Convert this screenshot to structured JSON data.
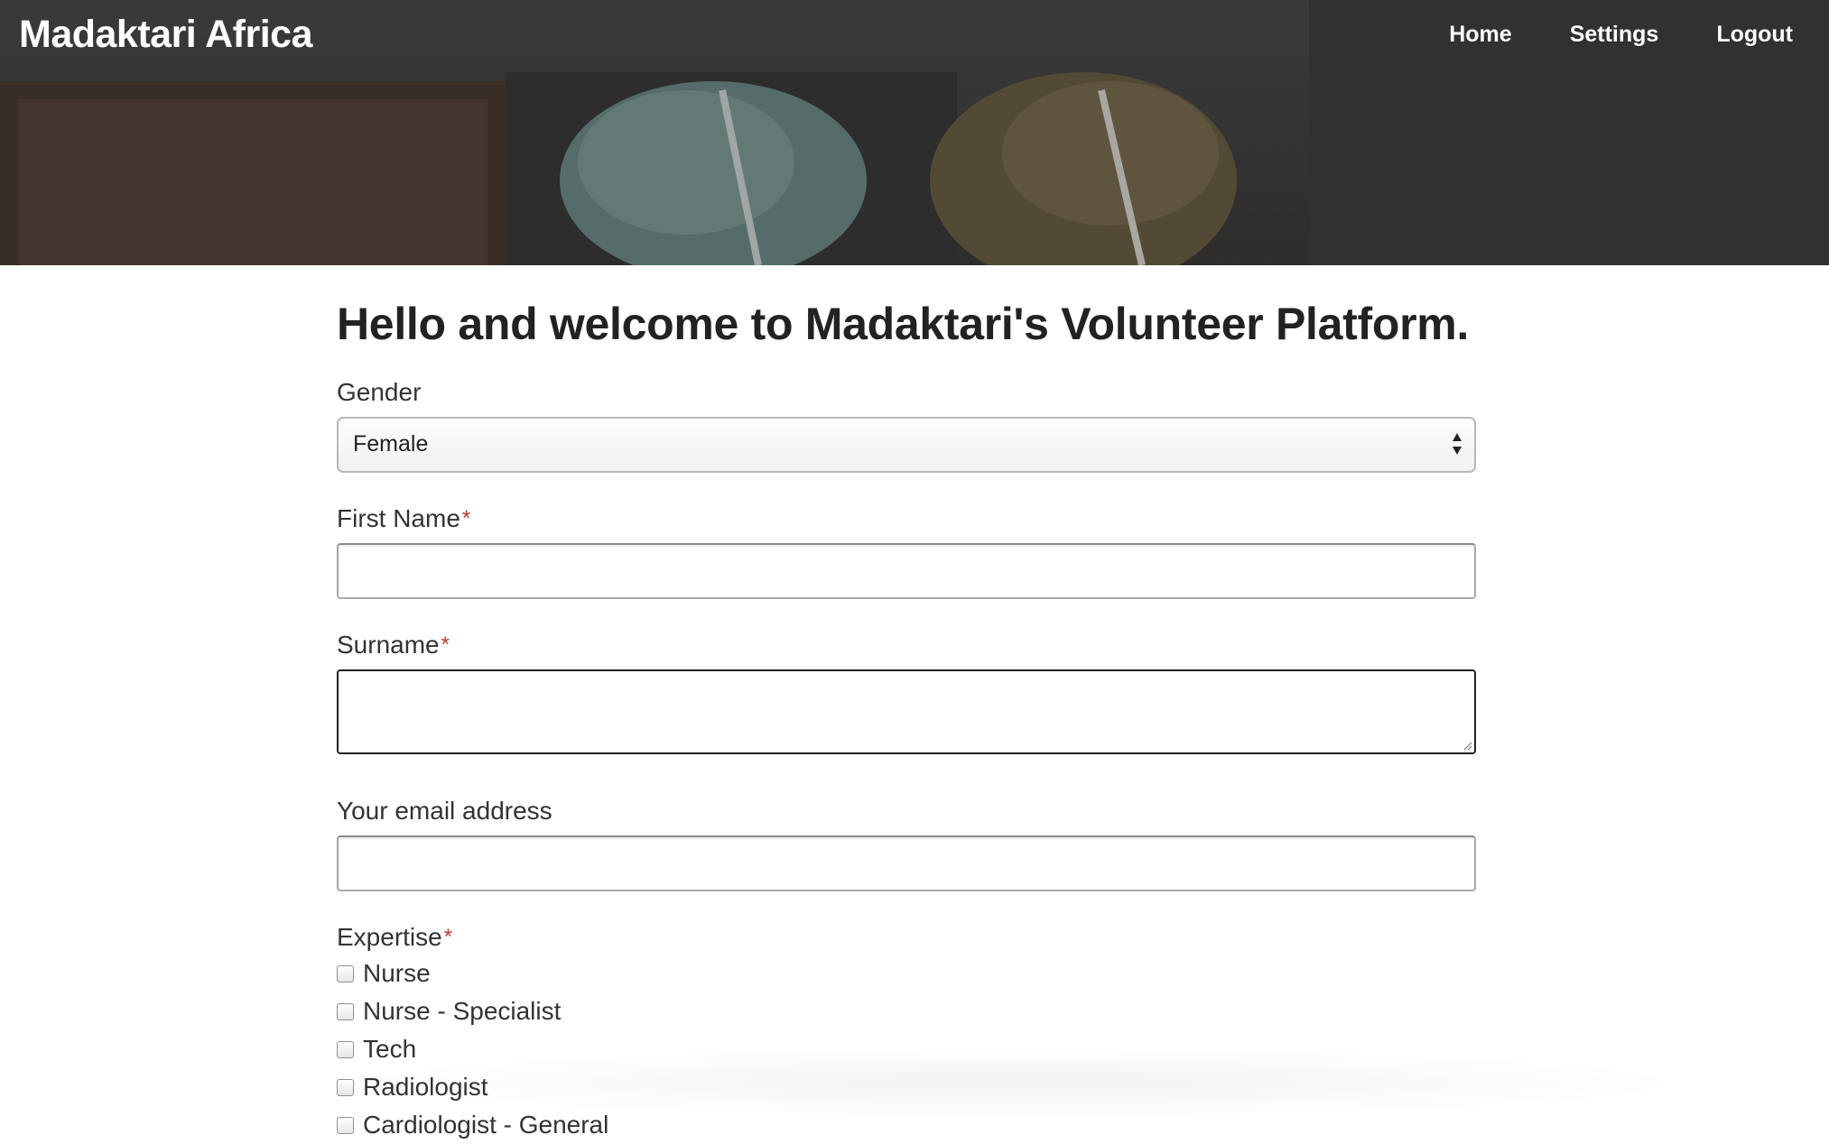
{
  "header": {
    "brand": "Madaktari Africa",
    "nav": [
      "Home",
      "Settings",
      "Logout"
    ]
  },
  "main": {
    "title": "Hello and welcome to Madaktari's Volunteer Platform.",
    "gender": {
      "label": "Gender",
      "selected": "Female"
    },
    "first_name": {
      "label": "First Name",
      "required_mark": "*",
      "value": ""
    },
    "surname": {
      "label": "Surname",
      "required_mark": "*",
      "value": ""
    },
    "email": {
      "label": "Your email address",
      "value": ""
    },
    "expertise": {
      "label": "Expertise",
      "required_mark": "*",
      "options": [
        "Nurse",
        "Nurse - Specialist",
        "Tech",
        "Radiologist",
        "Cardiologist - General"
      ]
    }
  },
  "colors": {
    "required": "#c0392b",
    "header_overlay": "#4a4a4a",
    "text": "#222222"
  },
  "icons": {
    "select": "up-down-arrows-icon",
    "textarea": "resize-grip-icon"
  }
}
